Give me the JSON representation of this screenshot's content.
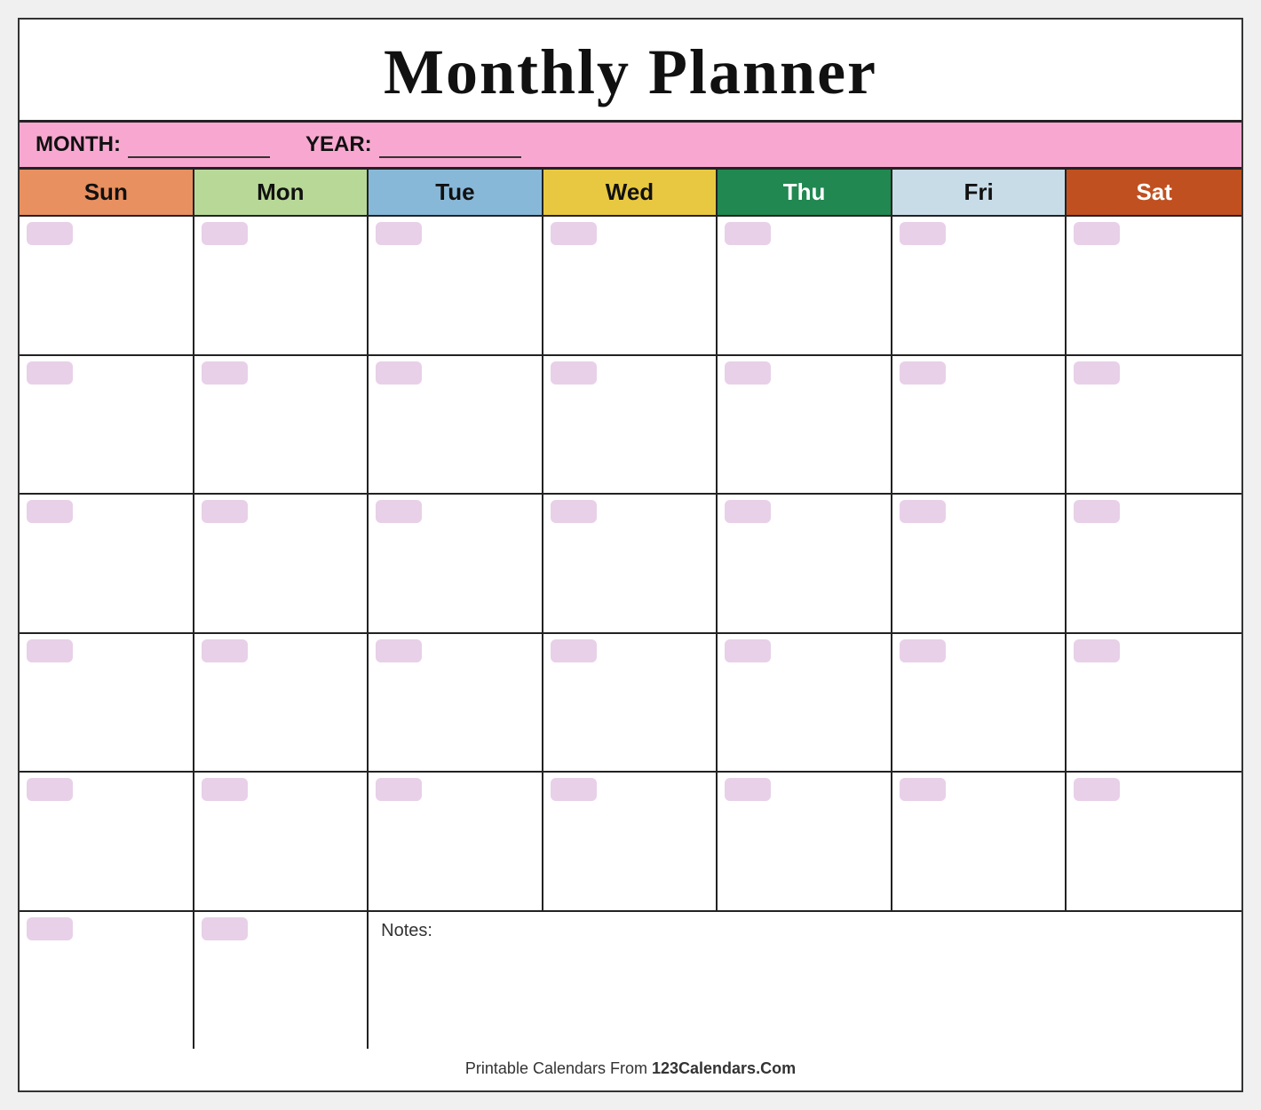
{
  "title": "Monthly Planner",
  "month_label": "MONTH:",
  "year_label": "YEAR:",
  "days": [
    {
      "key": "sun",
      "label": "Sun"
    },
    {
      "key": "mon",
      "label": "Mon"
    },
    {
      "key": "tue",
      "label": "Tue"
    },
    {
      "key": "wed",
      "label": "Wed"
    },
    {
      "key": "thu",
      "label": "Thu"
    },
    {
      "key": "fri",
      "label": "Fri"
    },
    {
      "key": "sat",
      "label": "Sat"
    }
  ],
  "notes_label": "Notes:",
  "footer_text": "Printable Calendars From ",
  "footer_brand": "123Calendars.Com",
  "rows": 6
}
